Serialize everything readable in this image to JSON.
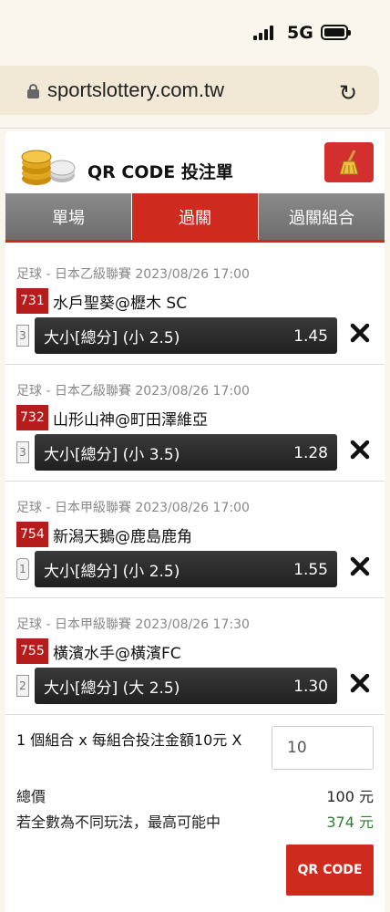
{
  "status_bar": {
    "network": "5G"
  },
  "browser": {
    "url": "sportslottery.com.tw"
  },
  "panel": {
    "title": "QR CODE 投注單",
    "tabs": [
      {
        "label": "單場",
        "active": false
      },
      {
        "label": "過關",
        "active": true
      },
      {
        "label": "過關組合",
        "active": false
      }
    ]
  },
  "bets": [
    {
      "league": "足球 - 日本乙級聯賽 2023/08/26 17:00",
      "number": "731",
      "match": "水戶聖葵@櫪木 SC",
      "count": "3",
      "selection": "大小[總分] (小 2.5)",
      "odds": "1.45"
    },
    {
      "league": "足球 - 日本乙級聯賽 2023/08/26 17:00",
      "number": "732",
      "match": "山形山神@町田澤維亞",
      "count": "3",
      "selection": "大小[總分] (小 3.5)",
      "odds": "1.28"
    },
    {
      "league": "足球 - 日本甲級聯賽 2023/08/26 17:00",
      "number": "754",
      "match": "新潟天鵝@鹿島鹿角",
      "count": "1",
      "selection": "大小[總分] (小 2.5)",
      "odds": "1.55"
    },
    {
      "league": "足球 - 日本甲級聯賽 2023/08/26 17:30",
      "number": "755",
      "match": "橫濱水手@橫濱FC",
      "count": "2",
      "selection": "大小[總分] (大 2.5)",
      "odds": "1.30"
    }
  ],
  "summary": {
    "combo_text": "1 個組合 x 每組合投注金額10元 X",
    "amount_value": "10",
    "total_label": "總價",
    "total_value": "100 元",
    "max_label": "若全數為不同玩法，最高可能中",
    "max_value": "374 元",
    "qr_button": "QR CODE"
  },
  "colors": {
    "accent": "#cf2a1e",
    "win": "#2e7d32",
    "background": "#fbf6ed"
  }
}
